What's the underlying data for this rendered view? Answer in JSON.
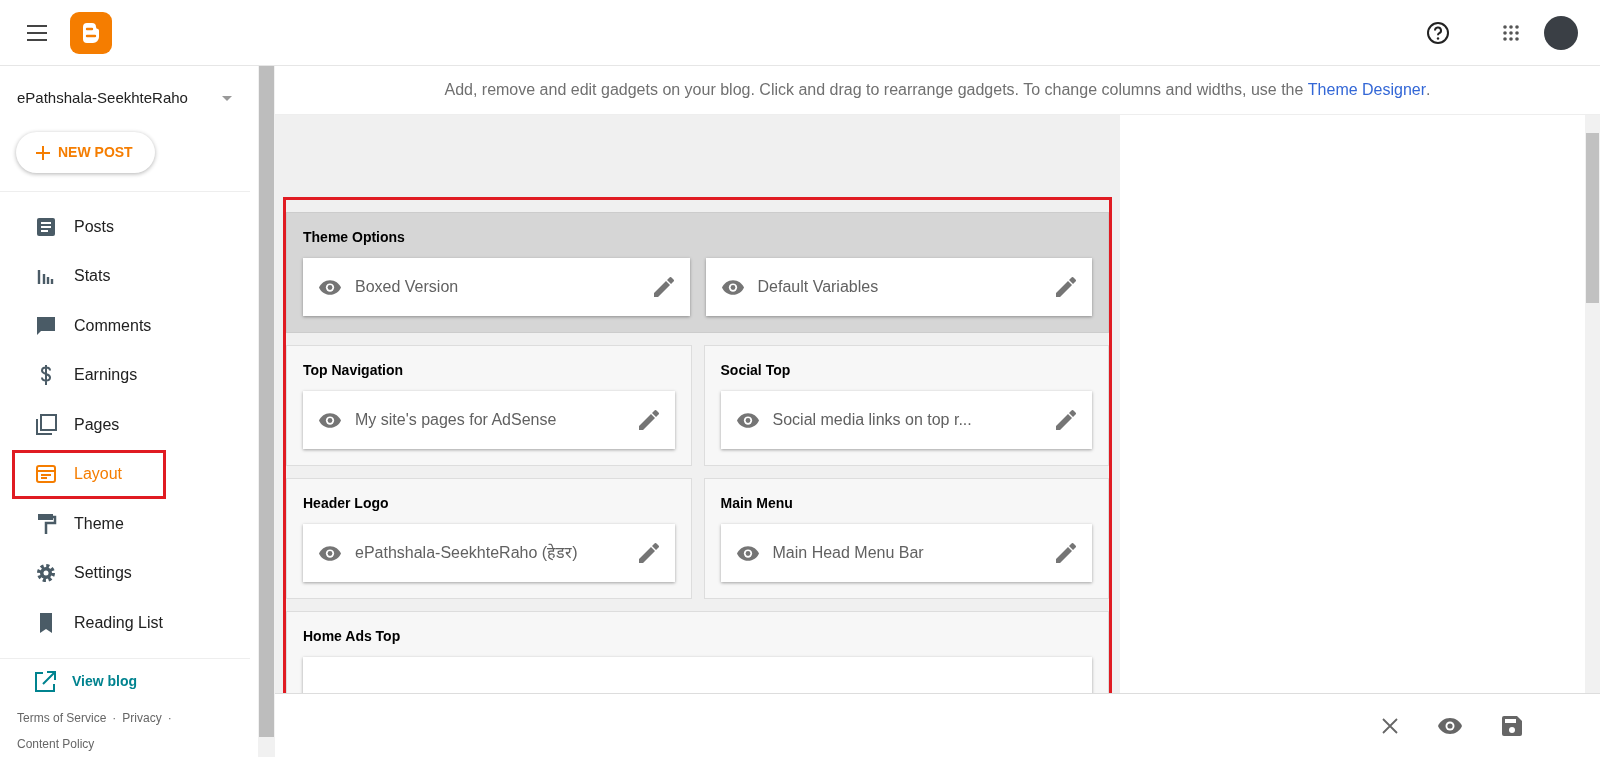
{
  "blog_name": "ePathshala-SeekhteRaho",
  "new_post": "NEW POST",
  "nav": [
    {
      "label": "Posts",
      "selected": false,
      "highlighted": false
    },
    {
      "label": "Stats",
      "selected": false,
      "highlighted": false
    },
    {
      "label": "Comments",
      "selected": false,
      "highlighted": false
    },
    {
      "label": "Earnings",
      "selected": false,
      "highlighted": false
    },
    {
      "label": "Pages",
      "selected": false,
      "highlighted": false
    },
    {
      "label": "Layout",
      "selected": true,
      "highlighted": true
    },
    {
      "label": "Theme",
      "selected": false,
      "highlighted": false
    },
    {
      "label": "Settings",
      "selected": false,
      "highlighted": false
    },
    {
      "label": "Reading List",
      "selected": false,
      "highlighted": false
    }
  ],
  "view_blog": "View blog",
  "footer_links": [
    "Terms of Service",
    "Privacy",
    "Content Policy"
  ],
  "footer_separator": "·",
  "description": {
    "text": "Add, remove and edit gadgets on your blog. Click and drag to rearrange gadgets. To change columns and widths, use the",
    "link": "Theme Designer",
    "end": "."
  },
  "layout_highlighted": true,
  "layout_rows": [
    {
      "sections": [
        {
          "title": "Theme Options",
          "highlighted": true,
          "cut_off": false,
          "gadgets": [
            "Boxed Version",
            "Default Variables"
          ]
        }
      ]
    },
    {
      "sections": [
        {
          "title": "Top Navigation",
          "highlighted": false,
          "cut_off": false,
          "gadgets": [
            "My site's pages for AdSense"
          ]
        },
        {
          "title": "Social Top",
          "highlighted": false,
          "cut_off": false,
          "gadgets": [
            "Social media links on top r..."
          ]
        }
      ]
    },
    {
      "sections": [
        {
          "title": "Header Logo",
          "highlighted": false,
          "cut_off": false,
          "gadgets": [
            "ePathshala-SeekhteRaho (हेडर)"
          ]
        },
        {
          "title": "Main Menu",
          "highlighted": false,
          "cut_off": false,
          "gadgets": [
            "Main Head Menu Bar"
          ]
        }
      ]
    },
    {
      "sections": [
        {
          "title": "Home Ads Top",
          "highlighted": false,
          "cut_off": true
        }
      ]
    }
  ]
}
